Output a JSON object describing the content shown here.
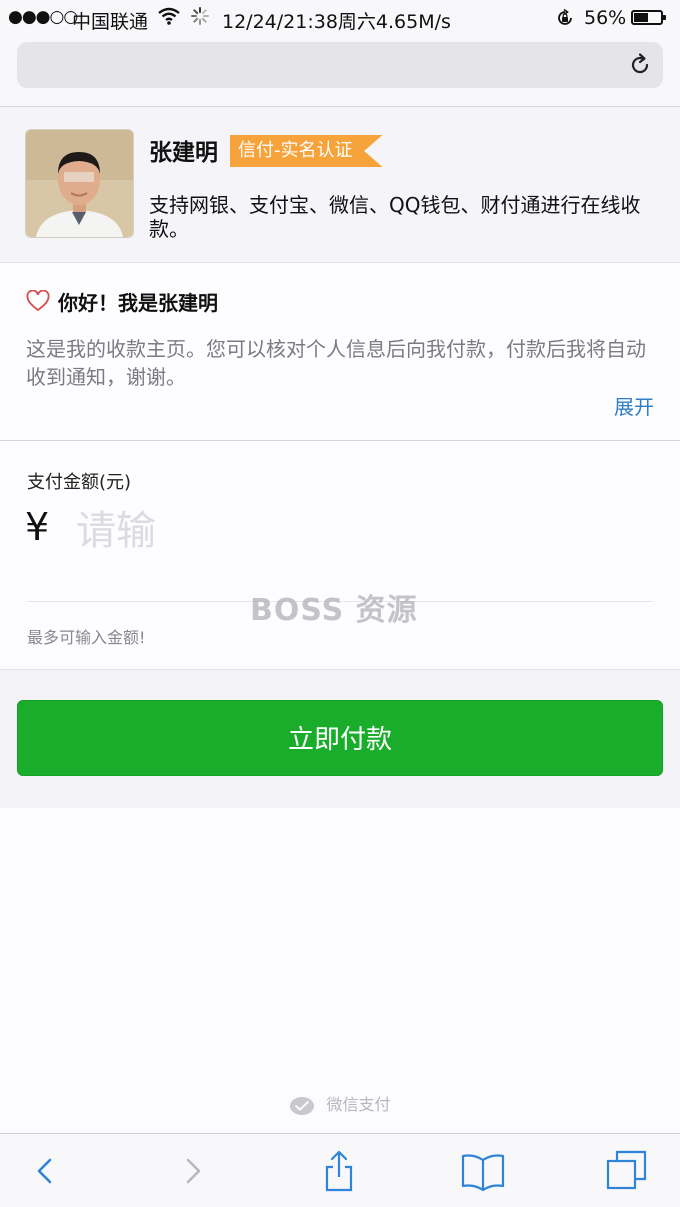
{
  "status_bar": {
    "signal": "●●●○○",
    "carrier": "中国联通",
    "time": "12/24/21:38周六4.65M/s",
    "battery_percent": "56%",
    "battery_level": 0.56
  },
  "profile": {
    "name": "张建明",
    "badge": "信付-实名认证",
    "description": "支持网银、支付宝、微信、QQ钱包、财付通进行在线收款。"
  },
  "greeting": {
    "title": "你好！我是张建明",
    "text": "这是我的收款主页。您可以核对个人信息后向我付款，付款后我将自动收到通知，谢谢。",
    "expand_label": "展开"
  },
  "amount": {
    "label": "支付金额(元)",
    "currency_symbol": "¥",
    "placeholder": "请输",
    "max_note": "最多可输入金额!"
  },
  "pay_button": {
    "label": "立即付款"
  },
  "watermark": "BOSS 资源",
  "footer": {
    "brand": "微信支付"
  },
  "colors": {
    "pay_green": "#1aad2b",
    "badge_orange": "#f6a33c",
    "link_blue": "#2e7fc5",
    "icon_blue": "#2f84d8"
  },
  "icons": {
    "reload": "reload-icon",
    "heart": "heart-outline-icon",
    "back": "chevron-left-icon",
    "forward": "chevron-right-icon",
    "share": "share-icon",
    "bookmarks": "book-icon",
    "tabs": "tabs-icon"
  }
}
